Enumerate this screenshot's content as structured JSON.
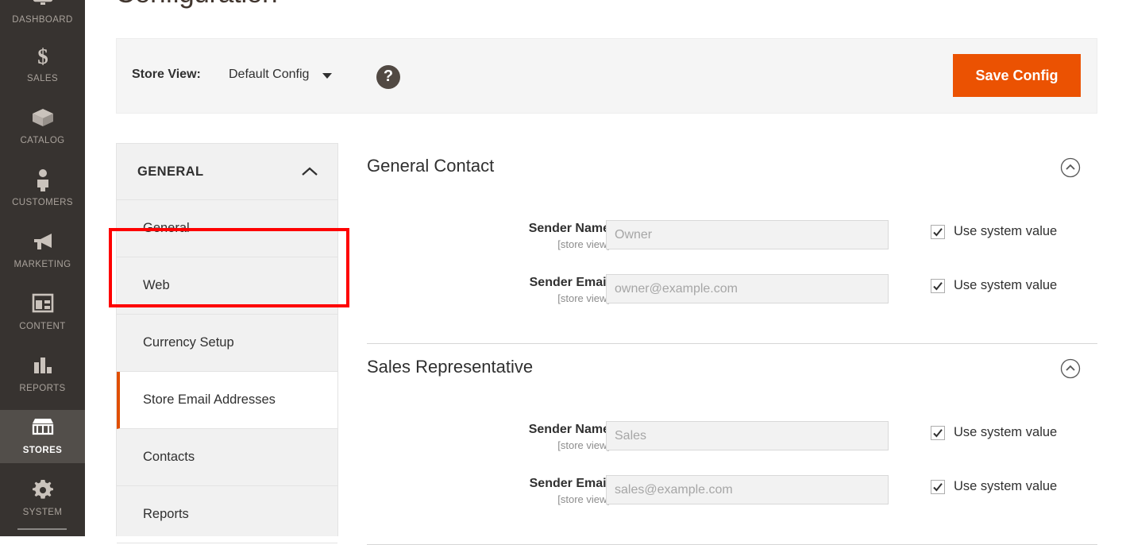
{
  "admin_nav": {
    "items": [
      {
        "label": "DASHBOARD",
        "icon": "dashboard-icon",
        "active": false
      },
      {
        "label": "SALES",
        "icon": "dollar-icon",
        "active": false
      },
      {
        "label": "CATALOG",
        "icon": "box-icon",
        "active": false
      },
      {
        "label": "CUSTOMERS",
        "icon": "person-icon",
        "active": false
      },
      {
        "label": "MARKETING",
        "icon": "megaphone-icon",
        "active": false
      },
      {
        "label": "CONTENT",
        "icon": "layout-icon",
        "active": false
      },
      {
        "label": "REPORTS",
        "icon": "bar-chart-icon",
        "active": false
      },
      {
        "label": "STORES",
        "icon": "storefront-icon",
        "active": true
      },
      {
        "label": "SYSTEM",
        "icon": "gear-icon",
        "active": false
      }
    ]
  },
  "page": {
    "title": "Configuration"
  },
  "store_bar": {
    "store_view_label": "Store View:",
    "store_view_value": "Default Config",
    "help_icon_glyph": "?",
    "save_button_label": "Save Config",
    "save_button_color": "#eb5202"
  },
  "config_nav": {
    "section_title": "GENERAL",
    "section_expanded": true,
    "items": [
      {
        "label": "General",
        "active": false
      },
      {
        "label": "Web",
        "active": false
      },
      {
        "label": "Currency Setup",
        "active": false
      },
      {
        "label": "Store Email Addresses",
        "active": true
      },
      {
        "label": "Contacts",
        "active": false
      },
      {
        "label": "Reports",
        "active": false
      }
    ],
    "highlight_color": "#fe0000",
    "active_marker_color": "#e04e00"
  },
  "config_content": {
    "groups": [
      {
        "title": "General Contact",
        "expanded": true,
        "fields": [
          {
            "label": "Sender Name",
            "scope": "[store view]",
            "value": "",
            "placeholder": "Owner",
            "system_label": "Use system value",
            "system_checked": true
          },
          {
            "label": "Sender Email",
            "scope": "[store view]",
            "value": "",
            "placeholder": "owner@example.com",
            "system_label": "Use system value",
            "system_checked": true
          }
        ]
      },
      {
        "title": "Sales Representative",
        "expanded": true,
        "fields": [
          {
            "label": "Sender Name",
            "scope": "[store view]",
            "value": "",
            "placeholder": "Sales",
            "system_label": "Use system value",
            "system_checked": true
          },
          {
            "label": "Sender Email",
            "scope": "[store view]",
            "value": "",
            "placeholder": "sales@example.com",
            "system_label": "Use system value",
            "system_checked": true
          }
        ]
      }
    ]
  }
}
